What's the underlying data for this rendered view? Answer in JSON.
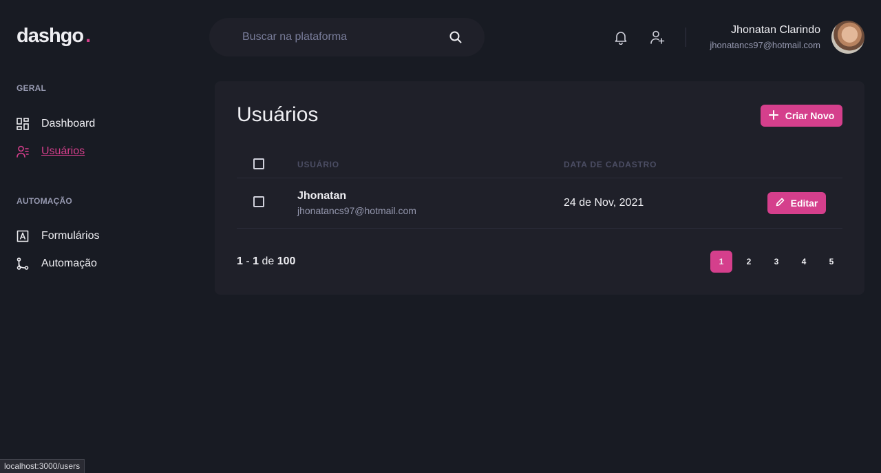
{
  "header": {
    "logo_text": "dashgo",
    "logo_dot": ".",
    "search_placeholder": "Buscar na plataforma",
    "profile": {
      "name": "Jhonatan Clarindo",
      "email": "jhonatancs97@hotmail.com"
    }
  },
  "sidebar": {
    "sections": [
      {
        "title": "GERAL",
        "items": [
          {
            "label": "Dashboard",
            "icon": "dashboard-icon"
          },
          {
            "label": "Usuários",
            "icon": "users-icon",
            "active": true
          }
        ]
      },
      {
        "title": "AUTOMAÇÃO",
        "items": [
          {
            "label": "Formulários",
            "icon": "form-icon"
          },
          {
            "label": "Automação",
            "icon": "git-branch-icon"
          }
        ]
      }
    ]
  },
  "main": {
    "title": "Usuários",
    "create_button": "Criar Novo",
    "table": {
      "headers": [
        "USUÁRIO",
        "DATA DE CADASTRO"
      ],
      "rows": [
        {
          "name": "Jhonatan",
          "email": "jhonatancs97@hotmail.com",
          "date": "24 de Nov, 2021",
          "action": "Editar"
        }
      ]
    },
    "pagination": {
      "start": "1",
      "sep": "-",
      "end": "1",
      "of": "de",
      "total": "100",
      "pages": [
        "1",
        "2",
        "3",
        "4",
        "5"
      ],
      "current": "1"
    }
  },
  "statusbar": {
    "url": "localhost:3000/users"
  },
  "colors": {
    "accent": "#d53f8c",
    "background": "#181b23",
    "card": "#1f2029"
  }
}
